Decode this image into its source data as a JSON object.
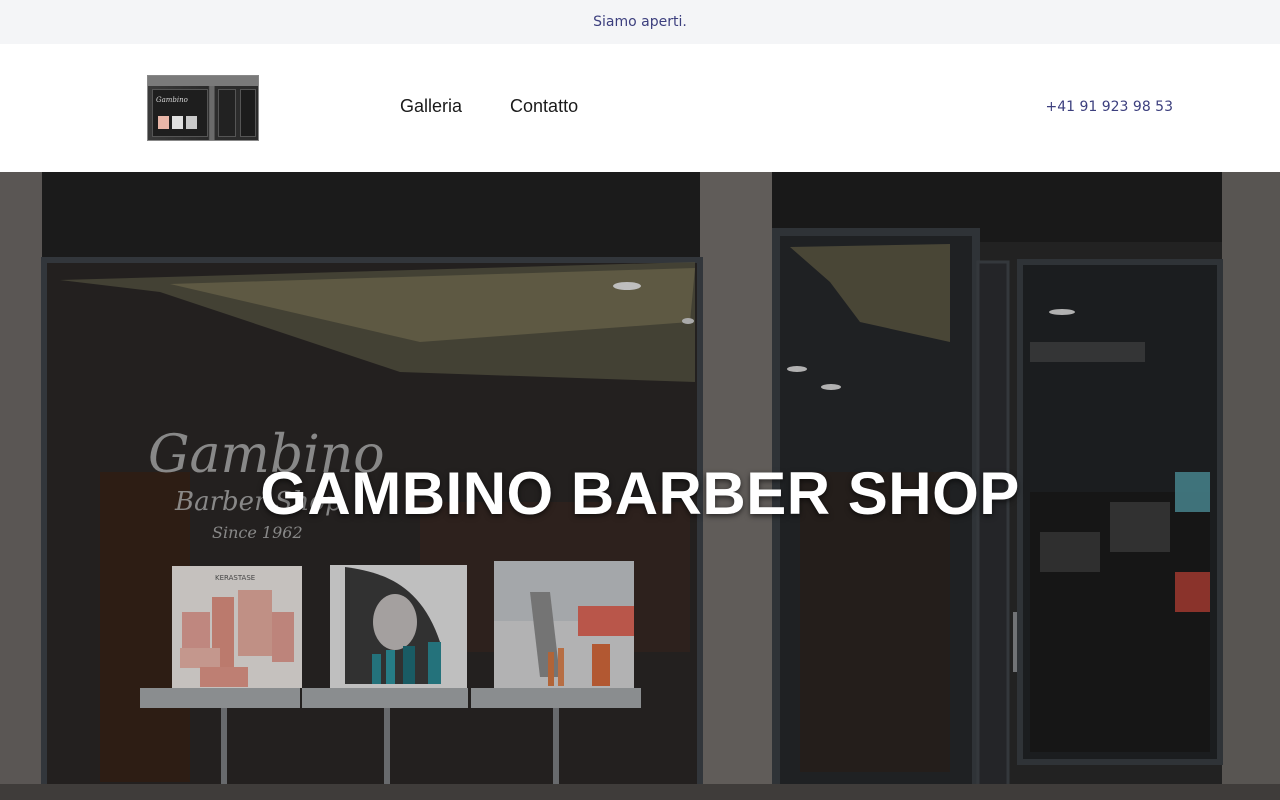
{
  "announcement": {
    "text": "Siamo aperti."
  },
  "header": {
    "logo_alt": "Gambino Barber Shop",
    "logo_text": "Gambino",
    "nav": [
      {
        "label": "Galleria"
      },
      {
        "label": "Contatto"
      }
    ],
    "phone": "+41 91 923 98 53"
  },
  "hero": {
    "title": "GAMBINO BARBER SHOP",
    "window_lettering": [
      "Gambino",
      "Barber Shop",
      "Since 1962"
    ],
    "poster_brand": "KERASTASE"
  },
  "colors": {
    "accent": "#3c3f7e",
    "announcement_bg": "#f4f5f7",
    "hero_text": "#ffffff"
  }
}
